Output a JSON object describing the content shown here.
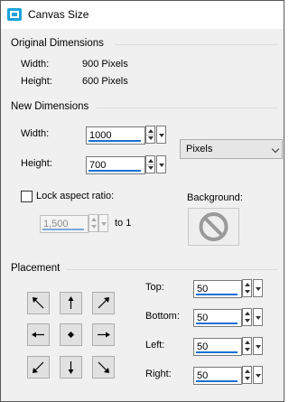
{
  "window": {
    "title": "Canvas Size",
    "icon": "canvas-size-icon"
  },
  "original": {
    "title": "Original Dimensions",
    "width_label": "Width:",
    "width_value": "900 Pixels",
    "height_label": "Height:",
    "height_value": "600 Pixels"
  },
  "new_dims": {
    "title": "New Dimensions",
    "width_label": "Width:",
    "width_value": "1000",
    "height_label": "Height:",
    "height_value": "700",
    "units": "Pixels",
    "lock_label": "Lock aspect ratio:",
    "lock_checked": false,
    "ratio_value": "1,500",
    "ratio_suffix": "to 1",
    "background_label": "Background:",
    "background_icon": "no-color-icon"
  },
  "placement": {
    "title": "Placement",
    "buttons": [
      "arrow-up-left-icon",
      "arrow-up-icon",
      "arrow-up-right-icon",
      "arrow-left-icon",
      "center-dot-icon",
      "arrow-right-icon",
      "arrow-down-left-icon",
      "arrow-down-icon",
      "arrow-down-right-icon"
    ],
    "top_label": "Top:",
    "top_value": "50",
    "bottom_label": "Bottom:",
    "bottom_value": "50",
    "left_label": "Left:",
    "left_value": "50",
    "right_label": "Right:",
    "right_value": "50"
  },
  "colors": {
    "accent": "#1a6fd1",
    "title_icon": "#1aa3d9"
  }
}
